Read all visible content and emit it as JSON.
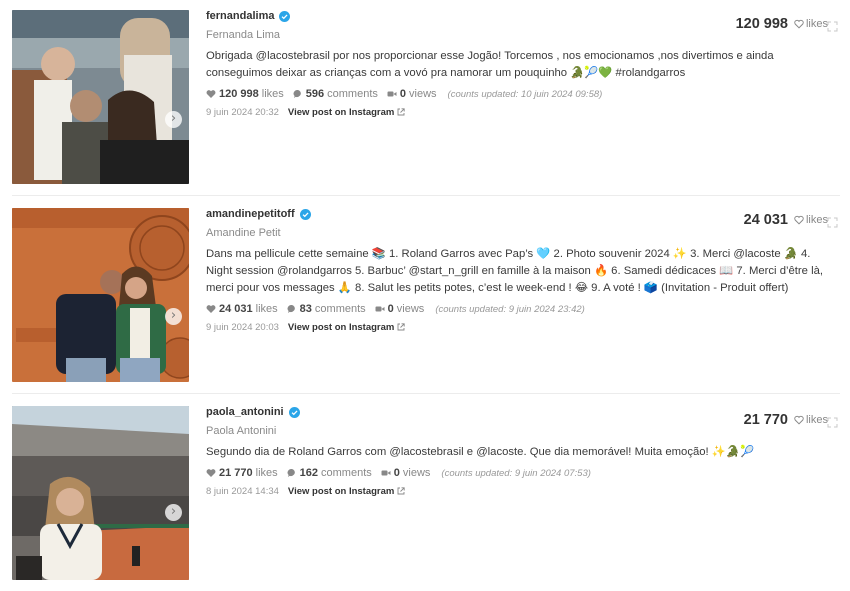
{
  "colors": {
    "verified": "#2ba5e8",
    "text": "#333333",
    "muted": "#8a8a8a"
  },
  "posts": [
    {
      "username": "fernandalima",
      "display_name": "Fernanda Lima",
      "likes_top": "120 998",
      "likes_word": "likes",
      "caption": "Obrigada @lacostebrasil por nos proporcionar esse Jogão! Torcemos , nos emocionamos ,nos divertimos e ainda conseguimos deixar as crianças com a vovó pra namorar um pouquinho 🐊🎾💚 #rolandgarros",
      "likes": "120 998",
      "likes_label": "likes",
      "comments": "596",
      "comments_label": "comments",
      "views": "0",
      "views_label": "views",
      "updated_prefix": "(counts updated:",
      "updated_date": "10 juin 2024 09:58",
      "updated_suffix": ")",
      "date": "9 juin 2024 20:32",
      "view_post": "View post on Instagram"
    },
    {
      "username": "amandinepetitoff",
      "display_name": "Amandine Petit",
      "likes_top": "24 031",
      "likes_word": "likes",
      "caption": "Dans ma pellicule cette semaine 📚 1. Roland Garros avec Pap’s 🩵 2. Photo souvenir 2024 ✨ 3. Merci @lacoste 🐊 4. Night session @rolandgarros 5. Barbuc’ @start_n_grill en famille à la maison 🔥 6. Samedi dédicaces 📖 7. Merci d’être là, merci pour vos messages 🙏 8. Salut les petits potes, c’est le week-end ! 😂 9. A voté ! 🗳️ (Invitation - Produit offert)",
      "likes": "24 031",
      "likes_label": "likes",
      "comments": "83",
      "comments_label": "comments",
      "views": "0",
      "views_label": "views",
      "updated_prefix": "(counts updated:",
      "updated_date": "9 juin 2024 23:42",
      "updated_suffix": ")",
      "date": "9 juin 2024 20:03",
      "view_post": "View post on Instagram"
    },
    {
      "username": "paola_antonini",
      "display_name": "Paola Antonini",
      "likes_top": "21 770",
      "likes_word": "likes",
      "caption": "Segundo dia de Roland Garros com @lacostebrasil e @lacoste. Que dia memorável! Muita emoção! ✨🐊🎾",
      "likes": "21 770",
      "likes_label": "likes",
      "comments": "162",
      "comments_label": "comments",
      "views": "0",
      "views_label": "views",
      "updated_prefix": "(counts updated:",
      "updated_date": "9 juin 2024 07:53",
      "updated_suffix": ")",
      "date": "8 juin 2024 14:34",
      "view_post": "View post on Instagram"
    }
  ]
}
